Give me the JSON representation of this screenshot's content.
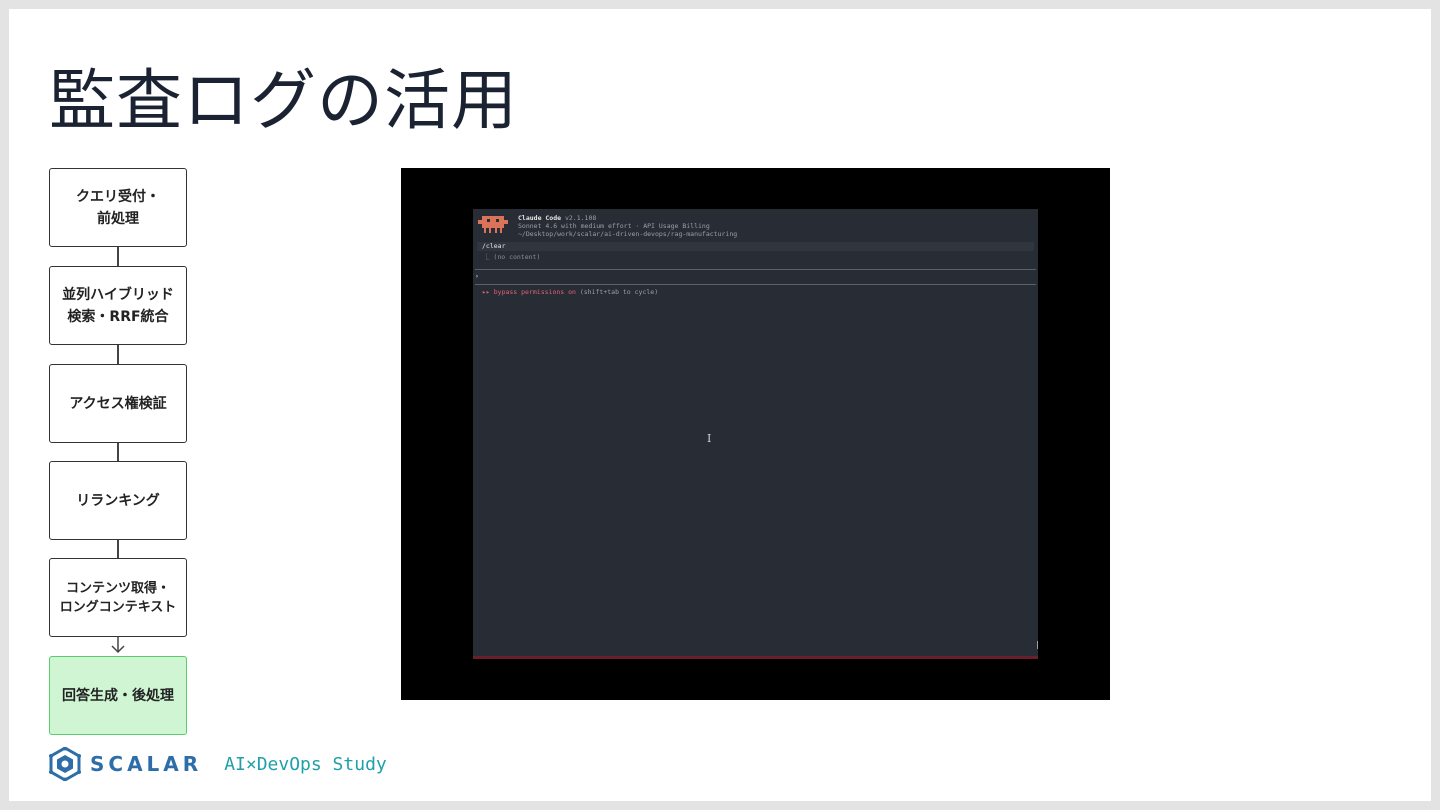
{
  "slide": {
    "title": "監査ログの活用"
  },
  "flow": {
    "steps": [
      "クエリ受付・\n前処理",
      "並列ハイブリッド\n検索・RRF統合",
      "アクセス権検証",
      "リランキング",
      "コンテンツ取得・\nロングコンテキスト",
      "回答生成・後処理"
    ]
  },
  "terminal": {
    "app_name": "Claude Code",
    "version": "v2.1.108",
    "model_line": "Sonnet 4.6 with medium effort · API Usage Billing",
    "path_line": "~/Desktop/work/scalar/ai-driven-devops/rag-manufacturing",
    "command": "/clear",
    "command_output": "⎿  (no content)",
    "prompt_symbol": "›",
    "permission_prefix": "▸▸ bypass permissions on",
    "permission_hint": "(shift+tab to cycle)",
    "cursor_glyph": "I"
  },
  "footer": {
    "logo_text": "SCALAR",
    "study_text": "AI×DevOps Study"
  },
  "colors": {
    "accent_green": "#cff5d3",
    "terminal_bg": "#282c34",
    "permission_red": "#e06478",
    "logo_blue": "#2e6ea8",
    "study_teal": "#20a0a8"
  }
}
